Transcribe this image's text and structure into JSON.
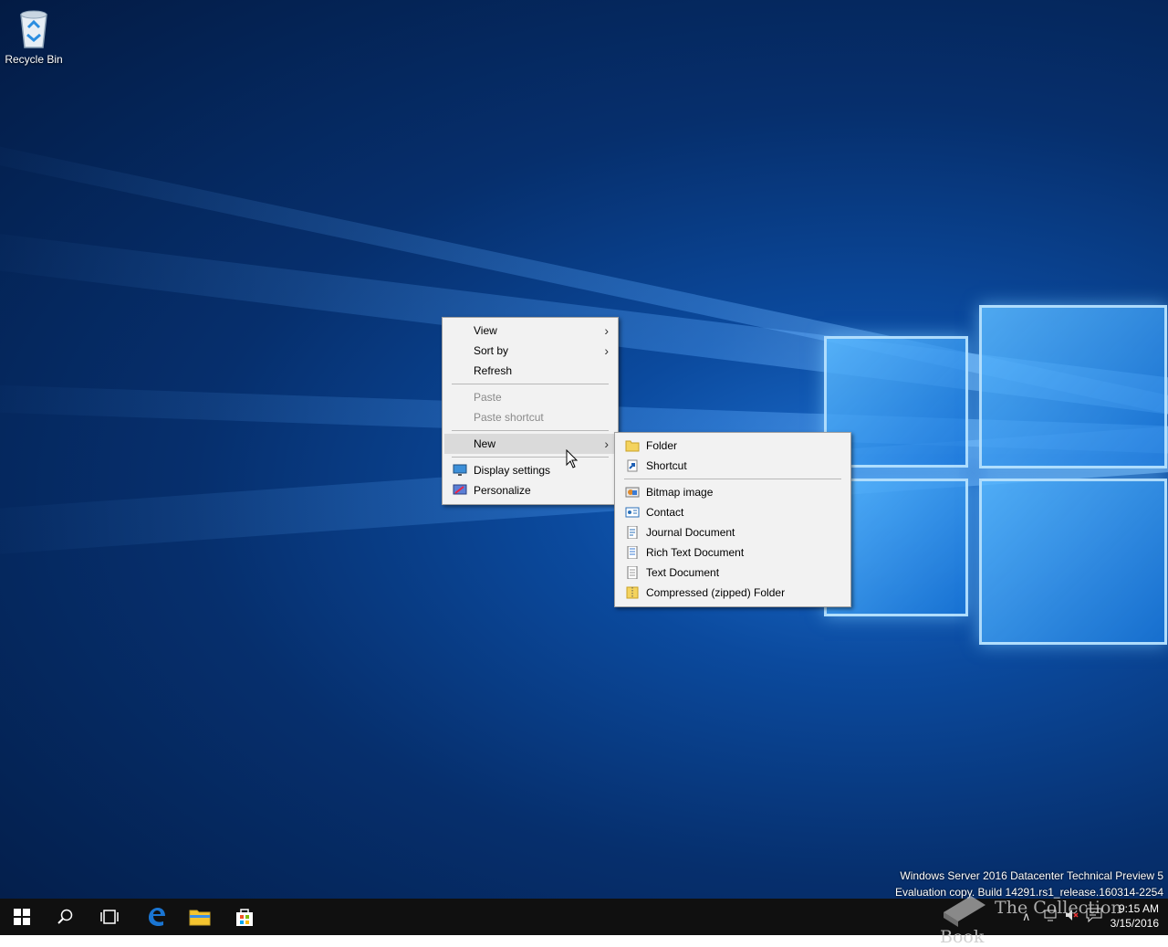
{
  "desktop": {
    "icons": [
      {
        "label": "Recycle Bin",
        "icon": "recycle-bin-icon"
      }
    ]
  },
  "context_menu": {
    "items": [
      {
        "label": "View",
        "submenu": true
      },
      {
        "label": "Sort by",
        "submenu": true
      },
      {
        "label": "Refresh"
      },
      {
        "label": "Paste",
        "disabled": true
      },
      {
        "label": "Paste shortcut",
        "disabled": true
      },
      {
        "label": "New",
        "submenu": true,
        "highlighted": true
      },
      {
        "label": "Display settings",
        "icon": "display-icon"
      },
      {
        "label": "Personalize",
        "icon": "personalize-icon"
      }
    ]
  },
  "new_submenu": {
    "items": [
      {
        "label": "Folder",
        "icon": "folder-icon"
      },
      {
        "label": "Shortcut",
        "icon": "shortcut-icon"
      },
      {
        "label": "Bitmap image",
        "icon": "bitmap-icon"
      },
      {
        "label": "Contact",
        "icon": "contact-icon"
      },
      {
        "label": "Journal Document",
        "icon": "journal-icon"
      },
      {
        "label": "Rich Text Document",
        "icon": "rich-text-icon"
      },
      {
        "label": "Text Document",
        "icon": "text-document-icon"
      },
      {
        "label": "Compressed (zipped) Folder",
        "icon": "zip-folder-icon"
      }
    ]
  },
  "watermark": {
    "line1": "Windows Server 2016 Datacenter Technical Preview 5",
    "line2": "Evaluation copy. Build 14291.rs1_release.160314-2254"
  },
  "overlay_text": "The Collection Book",
  "taskbar": {
    "clock_time": "9:15 AM",
    "clock_date": "3/15/2016"
  },
  "colors": {
    "menu_bg": "#f2f2f2",
    "highlight": "#dadada",
    "taskbar": "#101010",
    "edge_blue": "#1a75d2"
  }
}
